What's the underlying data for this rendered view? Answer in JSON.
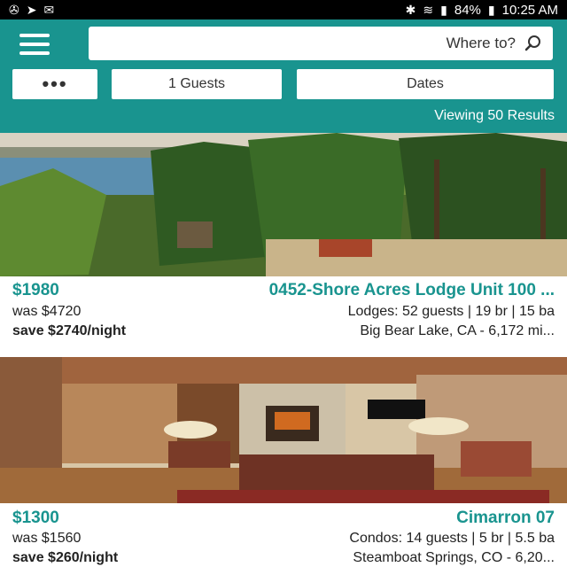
{
  "status_bar": {
    "time": "10:25 AM",
    "battery": "84%"
  },
  "header": {
    "search_placeholder": "Where to?",
    "filters": {
      "more_label": "•••",
      "guests_label": "1 Guests",
      "dates_label": "Dates"
    },
    "results_text": "Viewing 50 Results"
  },
  "listings": [
    {
      "title": "0452-Shore Acres Lodge Unit 100 ...",
      "price": "$1980",
      "details": "Lodges: 52 guests | 19 br | 15 ba",
      "was_price": "was $4720",
      "location": "Big Bear Lake, CA - 6,172 mi...",
      "savings": "save $2740/night"
    },
    {
      "title": "Cimarron 07",
      "price": "$1300",
      "details": "Condos: 14 guests | 5 br | 5.5 ba",
      "was_price": "was $1560",
      "location": "Steamboat Springs, CO - 6,20...",
      "savings": "save $260/night"
    }
  ],
  "colors": {
    "brand": "#19948f",
    "status_bar": "#000000"
  }
}
